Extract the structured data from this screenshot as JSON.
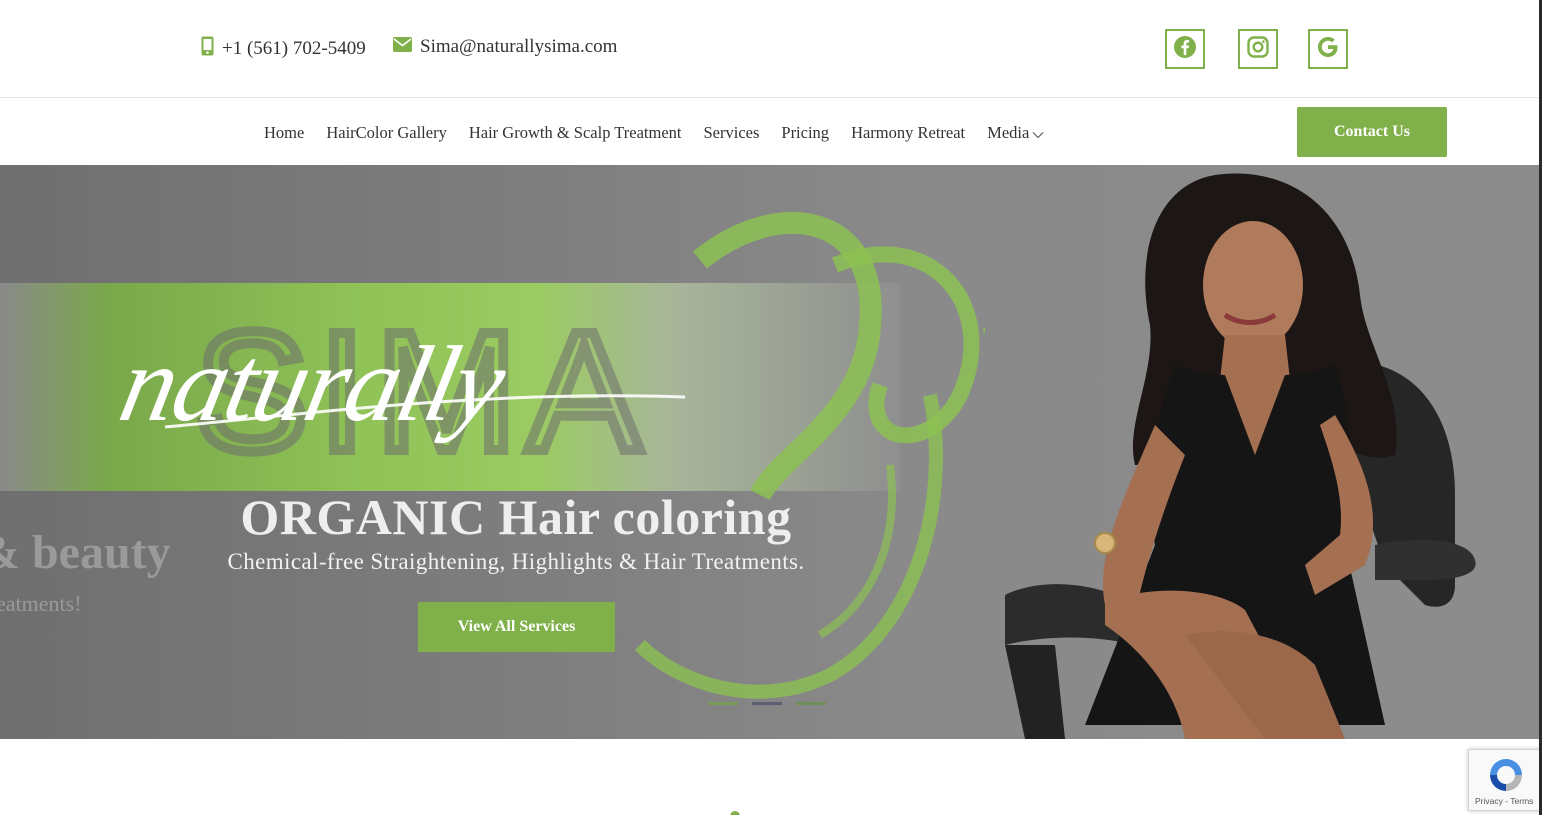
{
  "colors": {
    "accent": "#7fb04a",
    "nav_text": "#333333",
    "hero_bg": "#808080"
  },
  "topbar": {
    "phone": {
      "icon": "mobile-phone-icon",
      "text": "+1 (561) 702-5409"
    },
    "email": {
      "icon": "envelope-icon",
      "text": "Sima@naturallysima.com"
    },
    "social": [
      {
        "icon": "facebook-icon"
      },
      {
        "icon": "instagram-icon"
      },
      {
        "icon": "google-icon"
      }
    ]
  },
  "nav": {
    "items": [
      {
        "label": "Home"
      },
      {
        "label": "HairColor Gallery"
      },
      {
        "label": "Hair Growth & Scalp Treatment"
      },
      {
        "label": "Services"
      },
      {
        "label": "Pricing"
      },
      {
        "label": "Harmony Retreat"
      },
      {
        "label": "Media",
        "icon": "chevron-down-icon"
      }
    ],
    "cta": "Contact Us"
  },
  "hero": {
    "logo_script": "naturally",
    "logo_word": "SIMA",
    "ghost_title": "& beauty",
    "ghost_sub": "eatments!",
    "title": "ORGANIC Hair coloring",
    "subtitle": "Chemical-free Straightening, Highlights & Hair Treatments.",
    "button": "View All Services",
    "slides": {
      "count": 3,
      "active": 2
    }
  },
  "recaptcha": {
    "terms": "Privacy - Terms",
    "icon": "recaptcha-icon"
  }
}
